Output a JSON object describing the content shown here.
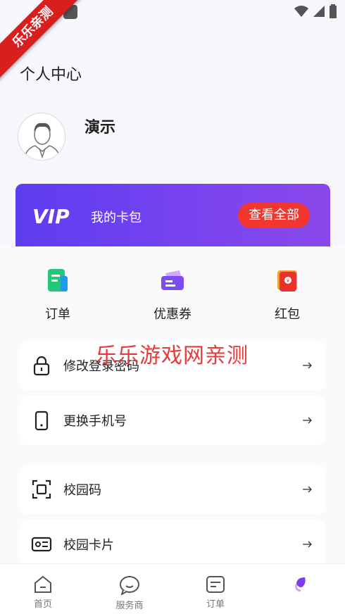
{
  "watermark_corner": "乐乐亲测",
  "header": {
    "title": "个人中心"
  },
  "profile": {
    "name": "演示"
  },
  "vip_card": {
    "logo_text": "VIP",
    "label": "我的卡包",
    "button": "查看全部"
  },
  "quick_actions": [
    {
      "label": "订单",
      "icon": "order-icon"
    },
    {
      "label": "优惠券",
      "icon": "coupon-icon"
    },
    {
      "label": "红包",
      "icon": "red-packet-icon"
    }
  ],
  "menu": [
    {
      "label": "修改登录密码",
      "icon": "lock-icon"
    },
    {
      "label": "更换手机号",
      "icon": "phone-icon"
    },
    {
      "label": "校园码",
      "icon": "scan-code-icon"
    },
    {
      "label": "校园卡片",
      "icon": "id-card-icon"
    }
  ],
  "watermark_center": "乐乐游戏网亲测",
  "tabbar": [
    {
      "label": "首页",
      "icon": "home-icon"
    },
    {
      "label": "服务商",
      "icon": "chat-bubble-icon"
    },
    {
      "label": "订单",
      "icon": "order-tab-icon"
    },
    {
      "label": "",
      "icon": "profile-tab-icon"
    }
  ],
  "colors": {
    "vip_gradient_start": "#5d3df0",
    "vip_gradient_end": "#8a48ea",
    "button_red": "#f2362f",
    "page_bg": "#f7f7fb"
  }
}
